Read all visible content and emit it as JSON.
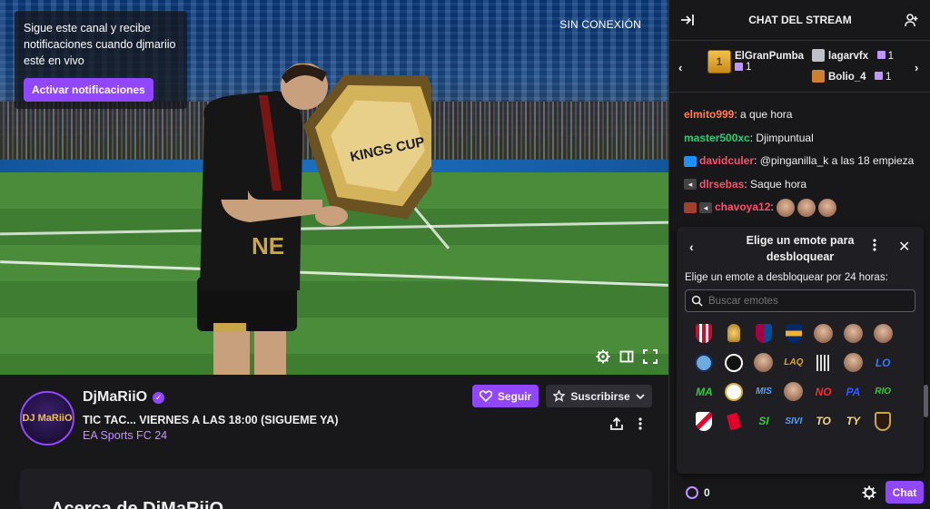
{
  "player": {
    "notification_text": "Sigue este canal y recibe notificaciones cuando djmariio esté en vivo",
    "notification_button": "Activar notificaciones",
    "status": "SIN CONEXIÓN",
    "controls": [
      "settings-icon",
      "theatre-mode-icon",
      "fullscreen-icon"
    ]
  },
  "channel": {
    "name": "DjMaRiiO",
    "avatar_text": "DJ MaRiiO",
    "title": "TIC TAC... VIERNES A LAS 18:00 (SIGUEME YA)",
    "game": "EA Sports FC 24",
    "follow_label": "Seguir",
    "subscribe_label": "Suscribirse",
    "about_title": "Acerca de DjMaRiiO"
  },
  "chat": {
    "header": "CHAT DEL STREAM",
    "gifters": {
      "top": {
        "name": "ElGranPumba",
        "rank": "1",
        "count": "1"
      },
      "others": [
        {
          "name": "lagarvfx",
          "count": "1"
        },
        {
          "name": "Bolio_4",
          "count": "1"
        }
      ]
    },
    "messages": [
      {
        "user": "elmito999",
        "color": "#ff7f50",
        "text": ": a que hora",
        "badges": []
      },
      {
        "user": "master500xc",
        "color": "#2ecc71",
        "text": ": Djimpuntual",
        "badges": []
      },
      {
        "user": "davidculer",
        "color": "#ff4f6b",
        "text": ": @pinganilla_k a las 18 empieza",
        "badges": [
          "crown"
        ]
      },
      {
        "user": "dlrsebas",
        "color": "#ff4f6b",
        "text": ": Saque hora",
        "badges": [
          "mute"
        ]
      },
      {
        "user": "chavoya12",
        "color": "#ff4f6b",
        "text": ":",
        "badges": [
          "shield",
          "mute"
        ]
      }
    ],
    "unlock": {
      "title": "Elige un emote para desbloquear",
      "subtitle": "Elige un emote a desbloquear por 24 horas:",
      "search_placeholder": "Buscar emotes",
      "emotes": [
        {
          "name": "atletico-crest-emote",
          "label": ""
        },
        {
          "name": "golden-ball-emote",
          "label": ""
        },
        {
          "name": "barcelona-crest-emote",
          "label": ""
        },
        {
          "name": "boca-crest-emote",
          "label": ""
        },
        {
          "name": "face-emote-1",
          "label": ""
        },
        {
          "name": "face-emote-2",
          "label": ""
        },
        {
          "name": "face-emote-3",
          "label": ""
        },
        {
          "name": "man-city-crest-emote",
          "label": ""
        },
        {
          "name": "colo-colo-crest-emote",
          "label": ""
        },
        {
          "name": "face-emote-4",
          "label": ""
        },
        {
          "name": "laq-text-emote",
          "label": "LAQ"
        },
        {
          "name": "bars-emote",
          "label": ""
        },
        {
          "name": "face-emote-5",
          "label": ""
        },
        {
          "name": "lo-text-emote",
          "label": "LO"
        },
        {
          "name": "ma-text-emote",
          "label": "MA"
        },
        {
          "name": "real-madrid-crest-emote",
          "label": ""
        },
        {
          "name": "mis-text-emote",
          "label": "MIS"
        },
        {
          "name": "face-emote-6",
          "label": ""
        },
        {
          "name": "no-text-emote",
          "label": "NO"
        },
        {
          "name": "pa-text-emote",
          "label": "PA"
        },
        {
          "name": "rio-text-emote",
          "label": "RIO"
        },
        {
          "name": "river-crest-emote",
          "label": ""
        },
        {
          "name": "red-card-emote",
          "label": ""
        },
        {
          "name": "si-text-emote",
          "label": "SI"
        },
        {
          "name": "sivi-text-emote",
          "label": "SIVI"
        },
        {
          "name": "to-text-emote",
          "label": "TO"
        },
        {
          "name": "ty-text-emote",
          "label": "TY"
        },
        {
          "name": "kings-crest-emote",
          "label": ""
        }
      ]
    },
    "points": "0",
    "chat_button": "Chat"
  }
}
